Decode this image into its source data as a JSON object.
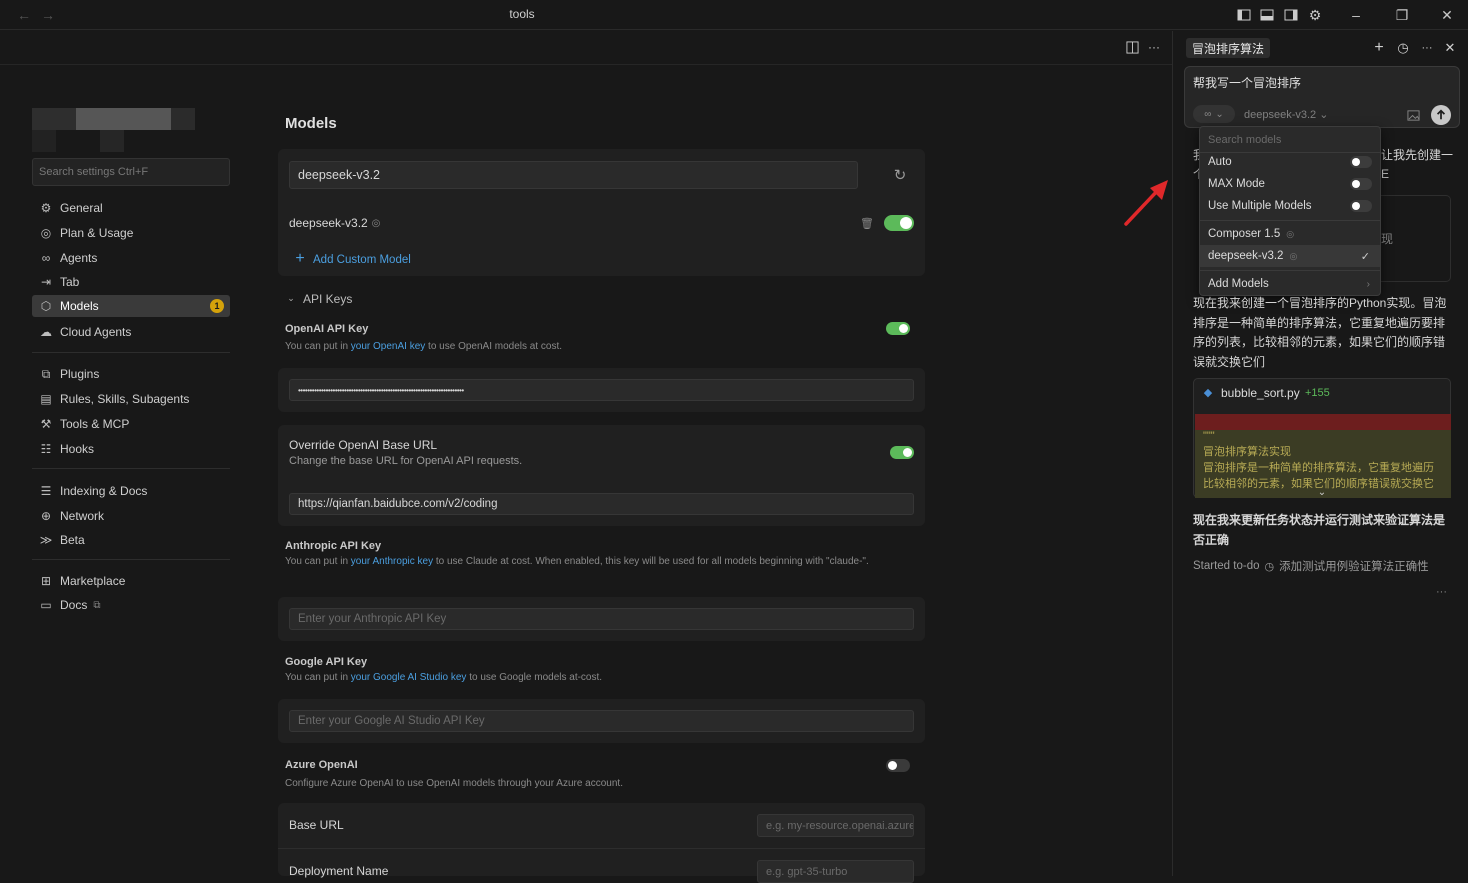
{
  "window": {
    "title": "tools"
  },
  "settings": {
    "search_placeholder": "Search settings Ctrl+F",
    "nav": [
      {
        "label": "General",
        "icon": "gear-icon"
      },
      {
        "label": "Plan & Usage",
        "icon": "plan-icon"
      },
      {
        "label": "Agents",
        "icon": "infinity-icon"
      },
      {
        "label": "Tab",
        "icon": "tab-arrow-icon"
      },
      {
        "label": "Models",
        "icon": "cube-icon",
        "badge": "1",
        "active": true
      },
      {
        "label": "Cloud Agents",
        "icon": "cloud-icon"
      },
      {
        "label": "Plugins",
        "icon": "plugin-icon"
      },
      {
        "label": "Rules, Skills, Subagents",
        "icon": "rules-icon"
      },
      {
        "label": "Tools & MCP",
        "icon": "tools-icon"
      },
      {
        "label": "Hooks",
        "icon": "hooks-icon"
      },
      {
        "label": "Indexing & Docs",
        "icon": "database-icon"
      },
      {
        "label": "Network",
        "icon": "globe-icon"
      },
      {
        "label": "Beta",
        "icon": "beta-icon"
      },
      {
        "label": "Marketplace",
        "icon": "marketplace-icon"
      },
      {
        "label": "Docs",
        "icon": "book-icon"
      }
    ],
    "models_heading": "Models",
    "model_search_value": "deepseek-v3.2",
    "model_row": {
      "name": "deepseek-v3.2",
      "enabled": true
    },
    "add_custom_model": "Add Custom Model",
    "api_keys_heading": "API Keys",
    "openai": {
      "title": "OpenAI API Key",
      "desc_pre": "You can put in ",
      "desc_link": "your OpenAI key",
      "desc_post": " to use OpenAI models at cost.",
      "enabled": true,
      "value": "••••••••••••••••••••••••••••••••••••••••••••••••••••••••••••••••••••••••"
    },
    "override": {
      "title": "Override OpenAI Base URL",
      "desc": "Change the base URL for OpenAI API requests.",
      "enabled": true,
      "value": "https://qianfan.baidubce.com/v2/coding"
    },
    "anthropic": {
      "title": "Anthropic API Key",
      "desc_pre": "You can put in ",
      "desc_link": "your Anthropic key",
      "desc_post": " to use Claude at cost. When enabled, this key will be used for all models beginning with \"claude-\".",
      "placeholder": "Enter your Anthropic API Key"
    },
    "google": {
      "title": "Google API Key",
      "desc_pre": "You can put in ",
      "desc_link": "your Google AI Studio key",
      "desc_post": " to use Google models at-cost.",
      "placeholder": "Enter your Google AI Studio API Key"
    },
    "azure": {
      "title": "Azure OpenAI",
      "desc": "Configure Azure OpenAI to use OpenAI models through your Azure account.",
      "enabled": false,
      "base_url_label": "Base URL",
      "base_url_placeholder": "e.g. my-resource.openai.azure.com",
      "deployment_label": "Deployment Name",
      "deployment_placeholder": "e.g. gpt-35-turbo"
    }
  },
  "chat": {
    "tab_title": "冒泡排序算法",
    "prompt": "帮我写一个冒泡排序",
    "mode_label": "∞",
    "model_selected": "deepseek-v3.2",
    "dropdown": {
      "search_placeholder": "Search models",
      "toggles": [
        {
          "label": "Auto",
          "on": false
        },
        {
          "label": "MAX Mode",
          "on": false
        },
        {
          "label": "Use Multiple Models",
          "on": false
        }
      ],
      "models": [
        {
          "label": "Composer 1.5",
          "selected": false
        },
        {
          "label": "deepseek-v3.2",
          "selected": true
        }
      ],
      "add_models": "Add Models"
    },
    "partial_left_1": "我",
    "partial_left_2": "个",
    "partial_right_1": "让我先创建一",
    "partial_right_2": "E",
    "partial_right_3": "现",
    "message_1": "现在我来创建一个冒泡排序的Python实现。冒泡排序是一种简单的排序算法，它重复地遍历要排序的列表，比较相邻的元素，如果它们的顺序错误就交换它们",
    "file": {
      "name": "bubble_sort.py",
      "added": "+155"
    },
    "code_lines": [
      "\"\"\"",
      "冒泡排序算法实现",
      "冒泡排序是一种简单的排序算法，它重复地遍历",
      "比较相邻的元素，如果它们的顺序错误就交换它"
    ],
    "message_2": "现在我来更新任务状态并运行测试来验证算法是否正确",
    "todo_status": "Started to-do",
    "todo_text": "添加测试用例验证算法正确性",
    "more": "···"
  },
  "colors": {
    "accent_toggle": "#5cba5a",
    "link": "#4b9fe0",
    "badge": "#d4a20b",
    "arrow": "#e0282a"
  }
}
